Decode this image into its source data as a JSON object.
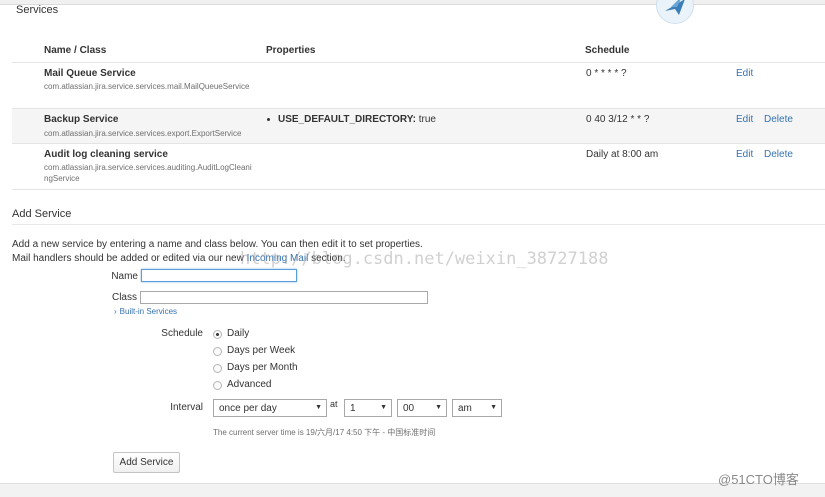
{
  "section_title": "Services",
  "table": {
    "headers": {
      "name_class": "Name / Class",
      "properties": "Properties",
      "schedule": "Schedule"
    },
    "rows": [
      {
        "name": "Mail Queue Service",
        "class": "com.atlassian.jira.service.services.mail.MailQueueService",
        "property_key": "",
        "property_value": "",
        "schedule": "0 * * * * ?",
        "edit": "Edit",
        "delete": ""
      },
      {
        "name": "Backup Service",
        "class": "com.atlassian.jira.service.services.export.ExportService",
        "property_key": "USE_DEFAULT_DIRECTORY:",
        "property_value": "true",
        "schedule": "0 40 3/12 * * ?",
        "edit": "Edit",
        "delete": "Delete"
      },
      {
        "name": "Audit log cleaning service",
        "class": "com.atlassian.jira.service.services.auditing.AuditLogCleaningService",
        "property_key": "",
        "property_value": "",
        "schedule": "Daily at 8:00 am",
        "edit": "Edit",
        "delete": "Delete"
      }
    ]
  },
  "add_service": {
    "title": "Add Service",
    "desc_line1": "Add a new service by entering a name and class below. You can then edit it to set properties.",
    "desc_line2_prefix": "Mail handlers should be added or edited via our new ",
    "desc_link": "Incoming Mail",
    "desc_line2_suffix": " section.",
    "name_label": "Name",
    "name_value": "",
    "class_label": "Class",
    "class_value": "",
    "builtin_link": "Built-in Services",
    "schedule_label": "Schedule",
    "schedule_options": [
      "Daily",
      "Days per Week",
      "Days per Month",
      "Advanced"
    ],
    "schedule_selected": "Daily",
    "interval_label": "Interval",
    "interval_value": "once per day",
    "at_label": "at",
    "hour_value": "1",
    "minute_value": "00",
    "ampm_value": "am",
    "server_time": "The current server time is 19/六月/17 4:50 下午 - 中国标准时间",
    "button_label": "Add Service"
  },
  "watermark": "http://blog.csdn.net/weixin_38727188",
  "corner_mark": "@51CTO博客",
  "colors": {
    "link": "#3572b0",
    "alt_row": "#f5f5f5",
    "border": "#e4e4e4"
  }
}
